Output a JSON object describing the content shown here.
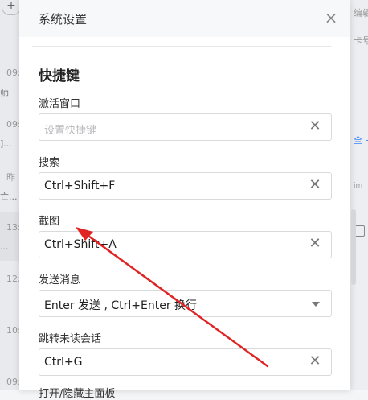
{
  "background": {
    "times": [
      "09:",
      "09:",
      "昨",
      "13:",
      "12:",
      "10:",
      "09:"
    ],
    "snippets": [
      "帅",
      "]...",
      "亡...",
      "...",
      ""
    ],
    "right_texts": [
      "编辑",
      "卡号",
      "全 +",
      "im",
      "",
      ""
    ]
  },
  "modal": {
    "title": "系统设置",
    "section_title": "快捷键",
    "fields": [
      {
        "label": "激活窗口",
        "value": "",
        "placeholder": "设置快捷键",
        "type": "shortcut"
      },
      {
        "label": "搜索",
        "value": "Ctrl+Shift+F",
        "placeholder": "",
        "type": "shortcut"
      },
      {
        "label": "截图",
        "value": "Ctrl+Shift+A",
        "placeholder": "",
        "type": "shortcut"
      },
      {
        "label": "发送消息",
        "value": "Enter 发送 , Ctrl+Enter 换行",
        "placeholder": "",
        "type": "select"
      },
      {
        "label": "跳转未读会话",
        "value": "Ctrl+G",
        "placeholder": "",
        "type": "shortcut"
      }
    ],
    "next_label_partial": "打开/隐藏主面板"
  },
  "annotation": {
    "arrow_color": "#e02424"
  },
  "icons": {
    "close": "close-icon",
    "clear": "clear-icon",
    "dropdown": "chevron-down-icon"
  }
}
